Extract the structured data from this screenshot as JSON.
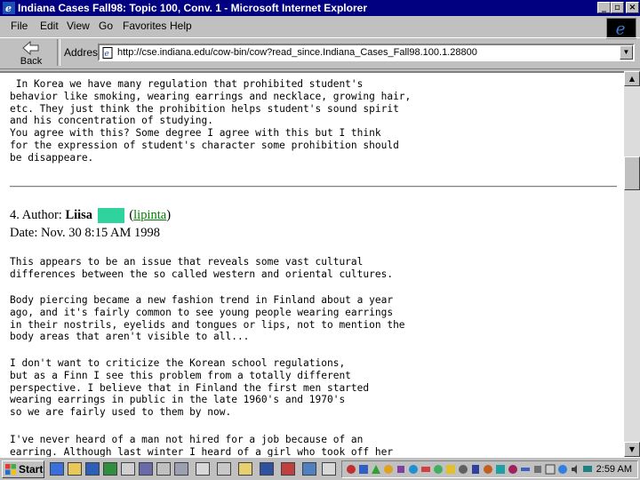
{
  "window": {
    "title": "Indiana Cases Fall98: Topic 100, Conv. 1 - Microsoft Internet Explorer",
    "controls": {
      "minimize": "_",
      "maximize": "▫",
      "close": "×"
    }
  },
  "menu": [
    "File",
    "Edit",
    "View",
    "Go",
    "Favorites",
    "Help"
  ],
  "toolbar": {
    "back_label": "Back",
    "address_label": "Address",
    "url": "http://cse.indiana.edu/cow-bin/cow?read_since.Indiana_Cases_Fall98.100.1.28800"
  },
  "content": {
    "prev_post_lines": [
      " In Korea we have many regulation that prohibited student's",
      "behavior like smoking, wearing earrings and necklace, growing hair,",
      "etc. They just think the prohibition helps student's sound spirit",
      "and his concentration of studying.",
      "You agree with this? Some degree I agree with this but I think",
      "for the expression of student's character some prohibition should",
      "be disappeare."
    ],
    "post": {
      "number": "4.",
      "author_label": "Author:",
      "author_name": "Liisa",
      "author_link": "lipinta",
      "date": "Date: Nov. 30 8:15 AM 1998",
      "paragraphs": [
        "This appears to be an issue that reveals some vast cultural\ndifferences between the so called western and oriental cultures.",
        "Body piercing became a new fashion trend in Finland about a year\nago, and it's fairly common to see young people wearing earrings\nin their nostrils, eyelids and tongues or lips, not to mention the\nbody areas that aren't visible to all...",
        "I don't want to criticize the Korean school regulations,\nbut as a Finn I see this problem from a totally different\nperspective. I believe that in Finland the first men started\nwearing earrings in public in the late 1960's and 1970's\nso we are fairly used to them by now.",
        "I've never heard of a man not hired for a job because of an\nearring. Although last winter I heard of a girl who took off her"
      ]
    }
  },
  "scrollbar": {
    "position_fraction": 0.22
  },
  "taskbar": {
    "start_label": "Start",
    "clock": "2:59 AM"
  }
}
